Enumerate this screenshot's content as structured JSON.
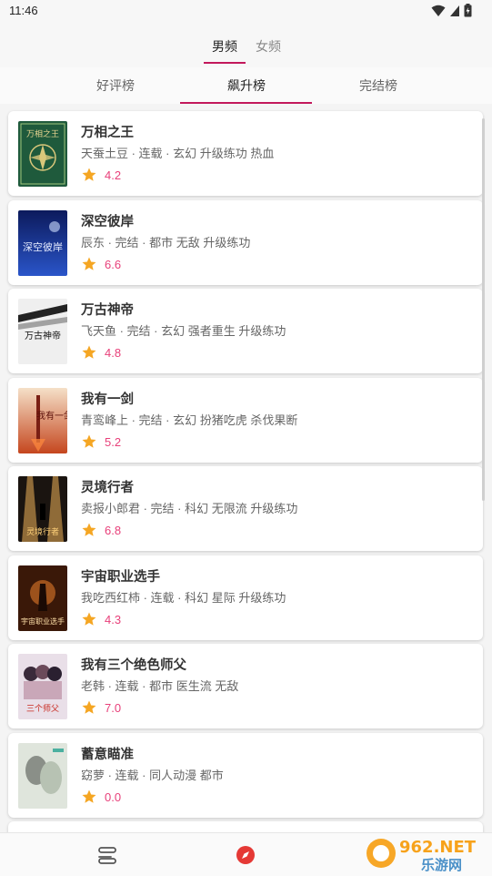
{
  "status_bar": {
    "time": "11:46"
  },
  "gender_tabs": [
    {
      "label": "男频",
      "active": true
    },
    {
      "label": "女频",
      "active": false
    }
  ],
  "rank_tabs": [
    {
      "label": "好评榜",
      "active": false
    },
    {
      "label": "飙升榜",
      "active": true
    },
    {
      "label": "完结榜",
      "active": false
    }
  ],
  "books": [
    {
      "title": "万相之王",
      "meta": "天蚕土豆 · 连载 · 玄幻 升级练功 热血",
      "score": "4.2",
      "cover_text": "万相之王"
    },
    {
      "title": "深空彼岸",
      "meta": "辰东 · 完结 · 都市 无敌 升级练功",
      "score": "6.6",
      "cover_text": "深空彼岸"
    },
    {
      "title": "万古神帝",
      "meta": "飞天鱼 · 完结 · 玄幻 强者重生 升级练功",
      "score": "4.8",
      "cover_text": "万古神帝"
    },
    {
      "title": "我有一剑",
      "meta": "青鸾峰上 · 完结 · 玄幻 扮猪吃虎 杀伐果断",
      "score": "5.2",
      "cover_text": "我有一剑"
    },
    {
      "title": "灵境行者",
      "meta": "卖报小郎君 · 完结 · 科幻 无限流 升级练功",
      "score": "6.8",
      "cover_text": "灵境行者"
    },
    {
      "title": "宇宙职业选手",
      "meta": "我吃西红柿 · 连载 · 科幻 星际 升级练功",
      "score": "4.3",
      "cover_text": "宇宙职业选手"
    },
    {
      "title": "我有三个绝色师父",
      "meta": "老韩 · 连载 · 都市 医生流 无敌",
      "score": "7.0",
      "cover_text": "三个师父"
    },
    {
      "title": "蓄意瞄准",
      "meta": "窈萝 · 连载 · 同人动漫 都市",
      "score": "0.0",
      "cover_text": ""
    }
  ],
  "watermark": {
    "top": "962.NET",
    "bottom": "乐游网"
  },
  "colors": {
    "accent": "#c2185b",
    "score": "#e8407a",
    "star": "#f5a623"
  },
  "icons": {
    "wifi": "wifi-icon",
    "battery": "battery-icon",
    "bookshelf": "bookshelf-icon",
    "discover": "compass-icon",
    "star": "star-icon"
  }
}
